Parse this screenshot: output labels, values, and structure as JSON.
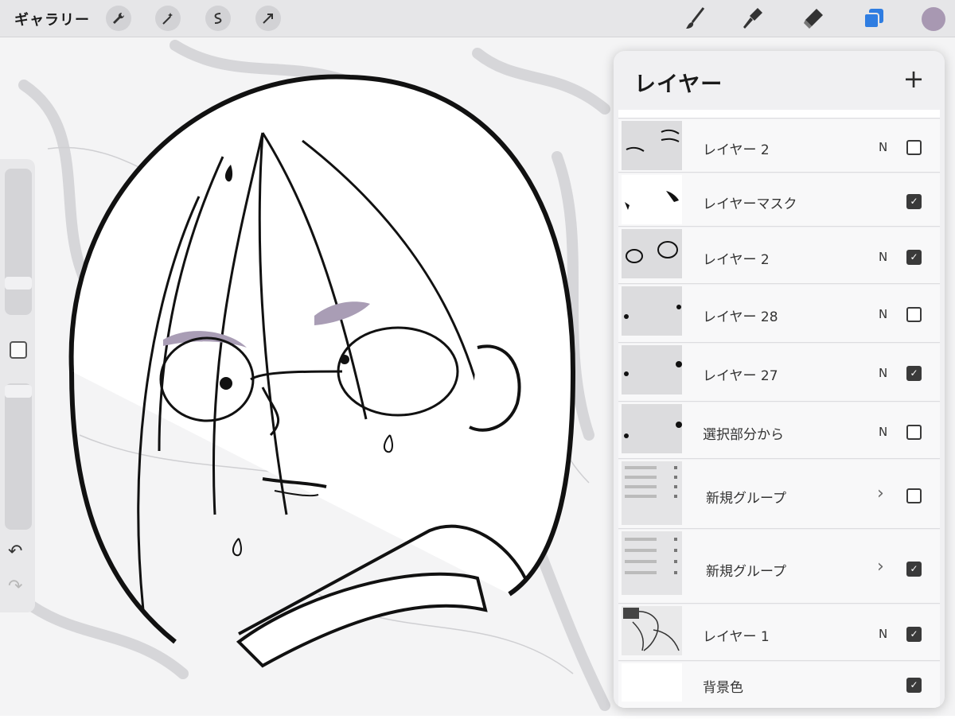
{
  "topbar": {
    "gallery_label": "ギャラリー",
    "tools": [
      "wrench-icon",
      "magic-wand-icon",
      "selection-icon",
      "transform-arrow-icon"
    ],
    "right_tools": [
      "brush-icon",
      "smudge-icon",
      "eraser-icon",
      "layers-icon"
    ],
    "accent_color": "#2f7de1",
    "color_swatch": "#a898b2"
  },
  "sidebar": {
    "undo": "↶",
    "redo": "↷"
  },
  "layers_panel": {
    "title": "レイヤー",
    "add_label": "+",
    "layers": [
      {
        "name": "レイヤー 2",
        "blend": "N",
        "visible": false
      },
      {
        "name": "レイヤーマスク",
        "blend": "",
        "visible": true
      },
      {
        "name": "レイヤー 2",
        "blend": "N",
        "visible": true
      },
      {
        "name": "レイヤー 28",
        "blend": "N",
        "visible": false
      },
      {
        "name": "レイヤー 27",
        "blend": "N",
        "visible": true
      },
      {
        "name": "選択部分から",
        "blend": "N",
        "visible": false
      },
      {
        "name": "新規グループ",
        "chevron": "›",
        "visible": false
      },
      {
        "name": "新規グループ",
        "chevron": "›",
        "visible": true
      },
      {
        "name": "レイヤー 1",
        "blend": "N",
        "visible": true
      },
      {
        "name": "背景色",
        "blend": "",
        "visible": true
      }
    ]
  },
  "canvas": {
    "eye_shadow_color": "#a99db5"
  }
}
